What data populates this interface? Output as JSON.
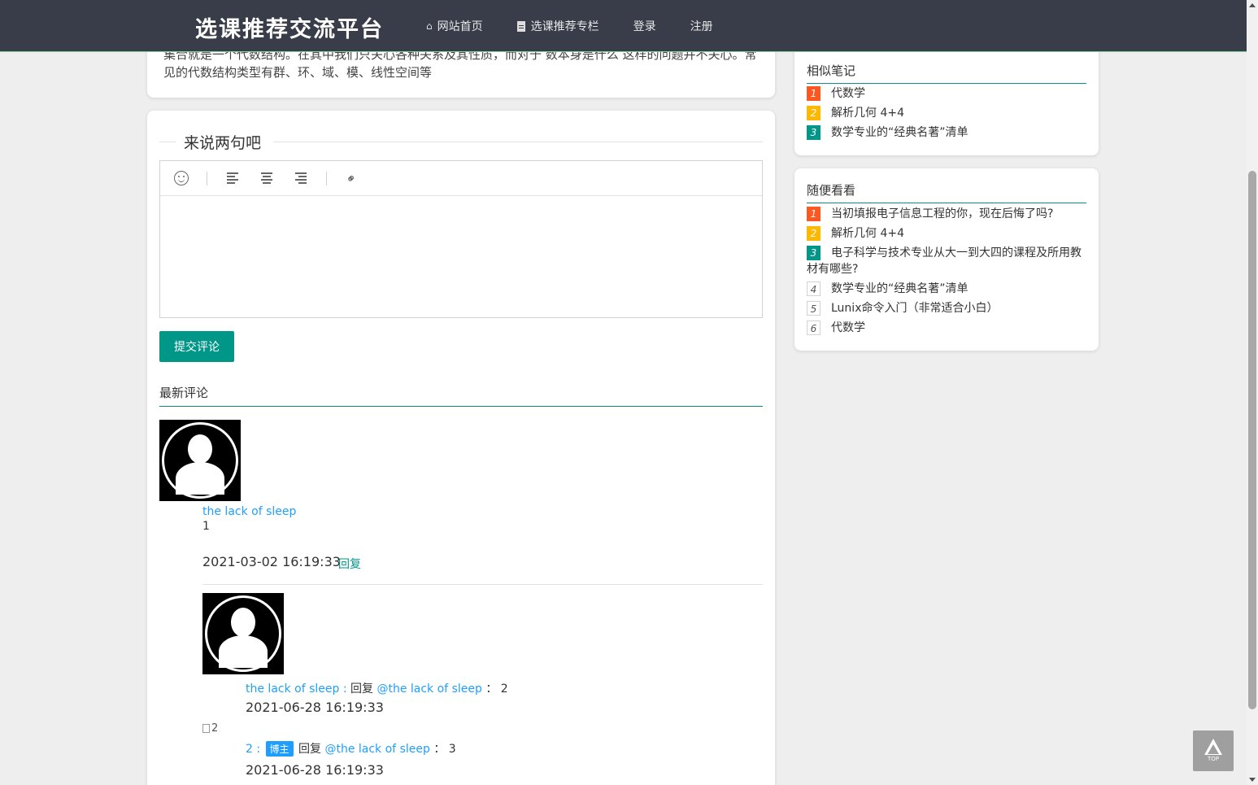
{
  "header": {
    "logo": "选课推荐交流平台",
    "nav": [
      {
        "label": "网站首页",
        "icon": "home-icon"
      },
      {
        "label": "选课推荐专栏",
        "icon": "document-icon"
      },
      {
        "label": "登录"
      },
      {
        "label": "注册"
      }
    ]
  },
  "article": {
    "text": "集合就是一个代数结构。在其中我们只关心各种关系及其性质，而对于 数本身是什么 这样的问题并不关心。常见的代数结构类型有群、环、域、模、线性空间等"
  },
  "comment_form": {
    "legend": "来说两句吧",
    "toolbar": [
      "smile-icon",
      "align-left-icon",
      "align-center-icon",
      "align-right-icon",
      "link-icon"
    ],
    "submit_label": "提交评论"
  },
  "comments": {
    "section_title": "最新评论",
    "main": {
      "author": "the lack of sleep",
      "content": "1",
      "time": "2021-03-02 16:19:33",
      "reply_label": "回复"
    },
    "replies": [
      {
        "author": "the lack of sleep",
        "separator": " :",
        "reply_word": "回复",
        "target": "@the lack of sleep",
        "content": "2",
        "time": "2021-06-28 16:19:33"
      },
      {
        "image_alt": "2",
        "author": "2",
        "separator": " :",
        "badge": "博主",
        "reply_word": "回复",
        "target": "@the lack of sleep",
        "content": "3",
        "time": "2021-06-28 16:19:33"
      }
    ]
  },
  "sidebar": {
    "similar": {
      "title": "相似笔记",
      "items": [
        {
          "num": "1",
          "text": "代数学"
        },
        {
          "num": "2",
          "text": "解析几何 4+4"
        },
        {
          "num": "3",
          "text": "数学专业的“经典名著”清单"
        }
      ]
    },
    "random": {
      "title": "随便看看",
      "items": [
        {
          "num": "1",
          "text": "当初填报电子信息工程的你，现在后悔了吗?"
        },
        {
          "num": "2",
          "text": "解析几何 4+4"
        },
        {
          "num": "3",
          "text": "电子科学与技术专业从大一到大四的课程及所用教材有哪些?"
        },
        {
          "num": "4",
          "text": "数学专业的“经典名著”清单"
        },
        {
          "num": "5",
          "text": "Lunix命令入门（非常适合小白）"
        },
        {
          "num": "6",
          "text": "代数学"
        }
      ]
    }
  },
  "back_to_top": {
    "label": "TOP"
  },
  "colors": {
    "header_bg": "#393d49",
    "accent": "#009688",
    "link": "#1e9fff",
    "rank1": "#ff5722",
    "rank2": "#ffb800"
  }
}
